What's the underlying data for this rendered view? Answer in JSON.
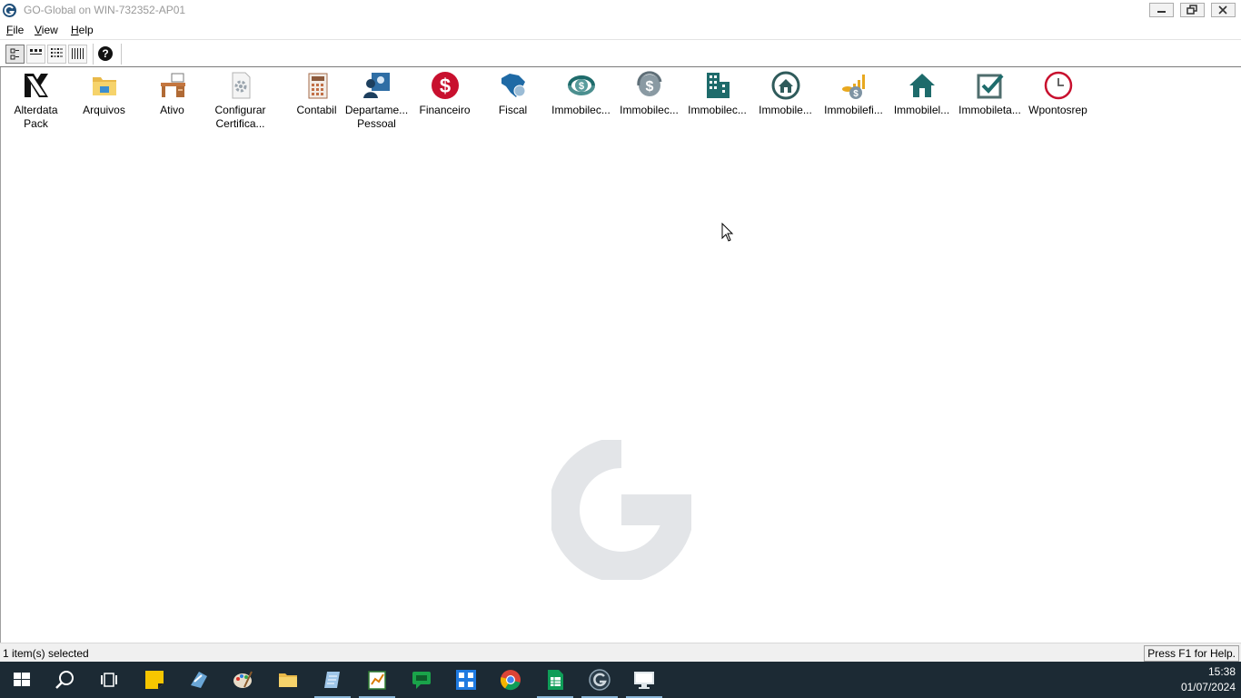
{
  "window": {
    "title": "GO-Global on WIN-732352-AP01"
  },
  "menu": {
    "items": [
      "File",
      "View",
      "Help"
    ],
    "underline": [
      "F",
      "V",
      "H"
    ],
    "rest": [
      "ile",
      "iew",
      "elp"
    ]
  },
  "toolbar": {
    "buttons": [
      "large-icons-view",
      "small-icons-view",
      "list-view",
      "details-view",
      "help"
    ]
  },
  "apps": [
    {
      "label": "Alterdata Pack",
      "icon": "alterdata-icon"
    },
    {
      "label": "Arquivos",
      "icon": "folder-icon"
    },
    {
      "label": "Ativo",
      "icon": "desk-icon"
    },
    {
      "label": "Configurar Certifica...",
      "icon": "gear-document-icon"
    },
    {
      "label": "Contabil",
      "icon": "calculator-icon"
    },
    {
      "label": "Departame... Pessoal",
      "icon": "person-card-icon"
    },
    {
      "label": "Financeiro",
      "icon": "dollar-icon"
    },
    {
      "label": "Fiscal",
      "icon": "brazil-map-icon"
    },
    {
      "label": "Immobilec...",
      "icon": "money-cycle-icon"
    },
    {
      "label": "Immobilec...",
      "icon": "money-cycle-gray-icon"
    },
    {
      "label": "Immobilec...",
      "icon": "buildings-icon"
    },
    {
      "label": "Immobile...",
      "icon": "house-circle-icon"
    },
    {
      "label": "Immobilefi...",
      "icon": "coins-chart-icon"
    },
    {
      "label": "Immobilel...",
      "icon": "house-icon"
    },
    {
      "label": "Immobileta...",
      "icon": "checkbox-icon"
    },
    {
      "label": "Wpontosrep",
      "icon": "clock-icon"
    }
  ],
  "status": {
    "left": "1 item(s) selected",
    "right": "Press F1 for Help."
  },
  "taskbar": {
    "time": "15:38",
    "date": "01/07/2024"
  },
  "colors": {
    "accent_red": "#c8102e",
    "accent_teal": "#1e6b6b",
    "taskbar": "#1c2a34"
  }
}
